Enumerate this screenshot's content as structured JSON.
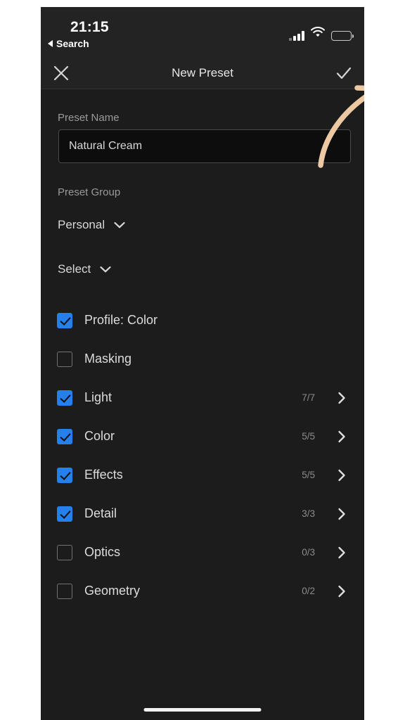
{
  "status_bar": {
    "time": "21:15",
    "back_label": "Search",
    "back_icon": "triangle-left-icon",
    "signal_icon": "cellular-signal-icon",
    "wifi_icon": "wifi-icon",
    "battery_icon": "battery-low-icon",
    "battery_level_percent": 24,
    "battery_color": "#f2251f"
  },
  "nav_bar": {
    "close_icon": "close-icon",
    "title": "New Preset",
    "confirm_icon": "checkmark-icon"
  },
  "form": {
    "name_label": "Preset Name",
    "name_value": "Natural Cream",
    "name_placeholder": "Preset Name",
    "group_label": "Preset Group",
    "group_value": "Personal",
    "group_chevron_icon": "chevron-down-icon",
    "select_value": "Select",
    "select_chevron_icon": "chevron-down-icon"
  },
  "settings": {
    "rows": [
      {
        "label": "Profile: Color",
        "checked": true,
        "count": "",
        "has_chevron": false
      },
      {
        "label": "Masking",
        "checked": false,
        "count": "",
        "has_chevron": false
      },
      {
        "label": "Light",
        "checked": true,
        "count": "7/7",
        "has_chevron": true
      },
      {
        "label": "Color",
        "checked": true,
        "count": "5/5",
        "has_chevron": true
      },
      {
        "label": "Effects",
        "checked": true,
        "count": "5/5",
        "has_chevron": true
      },
      {
        "label": "Detail",
        "checked": true,
        "count": "3/3",
        "has_chevron": true
      },
      {
        "label": "Optics",
        "checked": false,
        "count": "0/3",
        "has_chevron": true
      },
      {
        "label": "Geometry",
        "checked": false,
        "count": "0/2",
        "has_chevron": true
      }
    ],
    "checkbox_checked_color": "#2680eb",
    "chevron_icon": "chevron-right-icon"
  },
  "annotation": {
    "arrow_icon": "curved-arrow-icon",
    "arrow_color": "#edc9a3",
    "points_to": "checkmark-icon"
  },
  "home_indicator": {
    "icon": "home-indicator"
  },
  "theme": {
    "page_background": "#ffffff",
    "app_background": "#1c1c1c",
    "bar_background": "#232323",
    "accent": "#2680eb"
  }
}
